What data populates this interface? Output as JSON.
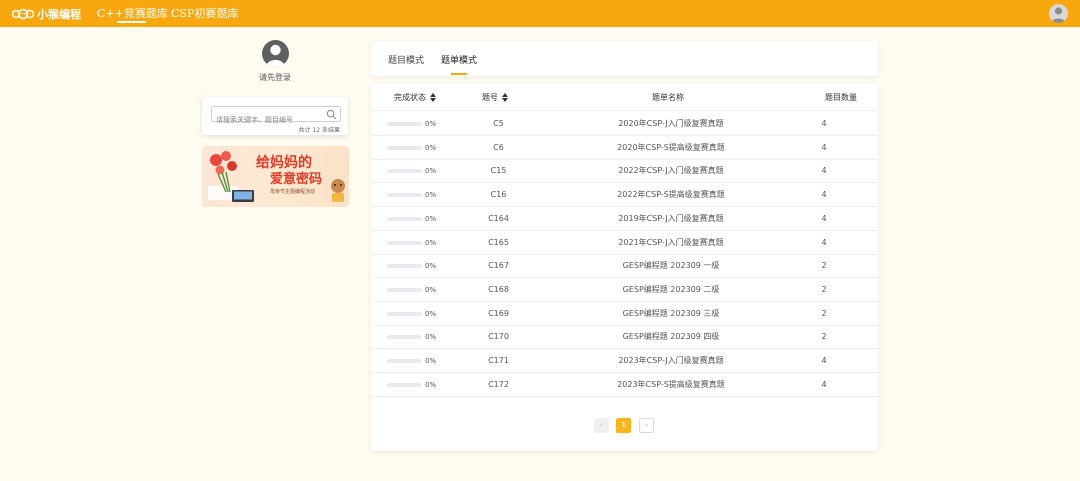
{
  "brand": {
    "name": "小猴编程"
  },
  "nav": [
    {
      "label": "C++竞赛题库"
    },
    {
      "label": "CSP初赛题库"
    }
  ],
  "login": {
    "text": "请先登录"
  },
  "search": {
    "placeholder": "请搜索关键字、题目编号",
    "result_text": "共计 12 条结果"
  },
  "banner": {
    "title_line1": "给妈妈的",
    "title_line2": "爱意密码",
    "subtitle": "母亲节主题编程活动"
  },
  "tabs": [
    {
      "label": "题目模式"
    },
    {
      "label": "题单模式",
      "active": true
    }
  ],
  "table": {
    "headers": {
      "status": "完成状态",
      "id": "题号",
      "name": "题单名称",
      "count": "题目数量"
    },
    "rows": [
      {
        "progress": 0,
        "progress_text": "0%",
        "id": "C5",
        "name": "2020年CSP-J入门级复赛真题",
        "count": "4"
      },
      {
        "progress": 0,
        "progress_text": "0%",
        "id": "C6",
        "name": "2020年CSP-S提高级复赛真题",
        "count": "4"
      },
      {
        "progress": 0,
        "progress_text": "0%",
        "id": "C15",
        "name": "2022年CSP-J入门级复赛真题",
        "count": "4"
      },
      {
        "progress": 0,
        "progress_text": "0%",
        "id": "C16",
        "name": "2022年CSP-S提高级复赛真题",
        "count": "4"
      },
      {
        "progress": 0,
        "progress_text": "0%",
        "id": "C164",
        "name": "2019年CSP-J入门级复赛真题",
        "count": "4"
      },
      {
        "progress": 0,
        "progress_text": "0%",
        "id": "C165",
        "name": "2021年CSP-J入门级复赛真题",
        "count": "4"
      },
      {
        "progress": 0,
        "progress_text": "0%",
        "id": "C167",
        "name": "GESP编程题 202309 一级",
        "count": "2"
      },
      {
        "progress": 0,
        "progress_text": "0%",
        "id": "C168",
        "name": "GESP编程题 202309 二级",
        "count": "2"
      },
      {
        "progress": 0,
        "progress_text": "0%",
        "id": "C169",
        "name": "GESP编程题 202309 三级",
        "count": "2"
      },
      {
        "progress": 0,
        "progress_text": "0%",
        "id": "C170",
        "name": "GESP编程题 202309 四级",
        "count": "2"
      },
      {
        "progress": 0,
        "progress_text": "0%",
        "id": "C171",
        "name": "2023年CSP-J入门级复赛真题",
        "count": "4"
      },
      {
        "progress": 0,
        "progress_text": "0%",
        "id": "C172",
        "name": "2023年CSP-S提高级复赛真题",
        "count": "4"
      }
    ]
  },
  "pagination": {
    "prev": "‹",
    "current": "1",
    "next": "›"
  },
  "colors": {
    "accent": "#f8a80e",
    "background": "#fefbf0",
    "progress_track": "#e7ebf0"
  }
}
